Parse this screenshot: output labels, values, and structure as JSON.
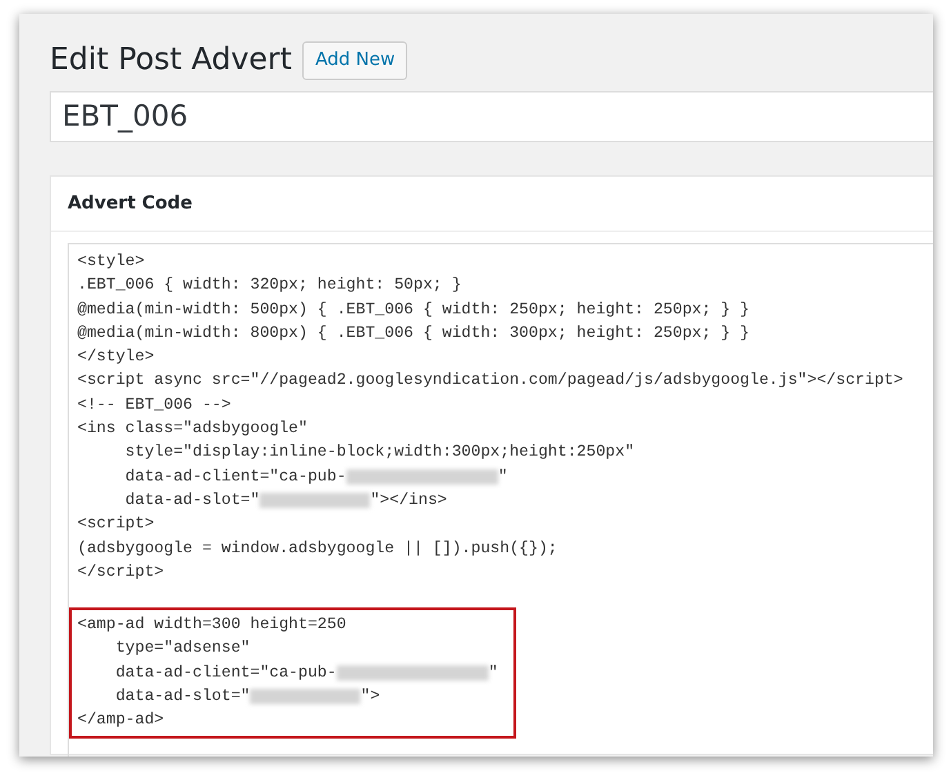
{
  "page": {
    "title": "Edit Post Advert",
    "add_new_button": "Add New"
  },
  "title_field": {
    "value": "EBT_006"
  },
  "advert_code": {
    "heading": "Advert Code",
    "blocks": [
      {
        "lines": [
          [
            {
              "kind": "text",
              "text": "<style>"
            }
          ],
          [
            {
              "kind": "text",
              "text": ".EBT_006 { width: 320px; height: 50px; }"
            }
          ],
          [
            {
              "kind": "text",
              "text": "@media(min-width: 500px) { .EBT_006 { width: 250px; height: 250px; } }"
            }
          ],
          [
            {
              "kind": "text",
              "text": "@media(min-width: 800px) { .EBT_006 { width: 300px; height: 250px; } }"
            }
          ],
          [
            {
              "kind": "text",
              "text": "</style>"
            }
          ],
          [
            {
              "kind": "text",
              "text": "<script async src=\"//pagead2.googlesyndication.com/pagead/js/adsbygoogle.js\"></script>"
            }
          ],
          [
            {
              "kind": "text",
              "text": "<!-- EBT_006 -->"
            }
          ],
          [
            {
              "kind": "text",
              "text": "<ins class=\"adsbygoogle\""
            }
          ],
          [
            {
              "kind": "text",
              "text": "     style=\"display:inline-block;width:300px;height:250px\""
            }
          ],
          [
            {
              "kind": "text",
              "text": "     data-ad-client=\"ca-pub-"
            },
            {
              "kind": "redacted_client"
            },
            {
              "kind": "text",
              "text": "\""
            }
          ],
          [
            {
              "kind": "text",
              "text": "     data-ad-slot=\""
            },
            {
              "kind": "redacted_slot"
            },
            {
              "kind": "text",
              "text": "\"></ins>"
            }
          ],
          [
            {
              "kind": "text",
              "text": "<script>"
            }
          ],
          [
            {
              "kind": "text",
              "text": "(adsbygoogle = window.adsbygoogle || []).push({});"
            }
          ],
          [
            {
              "kind": "text",
              "text": "</script>"
            }
          ]
        ]
      },
      {
        "highlighted": true,
        "lines": [
          [
            {
              "kind": "text",
              "text": "<amp-ad width=300 height=250"
            }
          ],
          [
            {
              "kind": "text",
              "text": "    type=\"adsense\""
            }
          ],
          [
            {
              "kind": "text",
              "text": "    data-ad-client=\"ca-pub-"
            },
            {
              "kind": "redacted_client"
            },
            {
              "kind": "text",
              "text": "\""
            }
          ],
          [
            {
              "kind": "text",
              "text": "    data-ad-slot=\""
            },
            {
              "kind": "redacted_slot"
            },
            {
              "kind": "text",
              "text": "\">"
            }
          ],
          [
            {
              "kind": "text",
              "text": "</amp-ad>"
            }
          ]
        ]
      }
    ]
  }
}
